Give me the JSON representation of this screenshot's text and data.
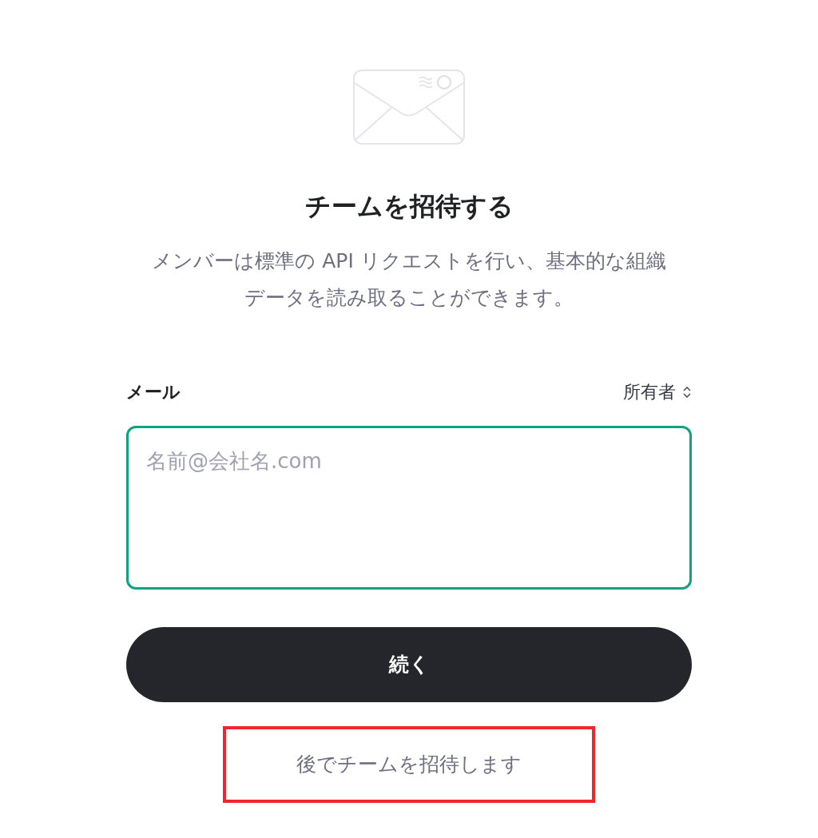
{
  "title": "チームを招待する",
  "description": "メンバーは標準の API リクエストを行い、基本的な組織データを読み取ることができます。",
  "email_field": {
    "label": "メール",
    "role": "所有者",
    "placeholder": "名前@会社名.com",
    "focused": true
  },
  "continue_button": "続く",
  "later_link": {
    "label": "後でチームを招待します",
    "highlighted": true
  }
}
